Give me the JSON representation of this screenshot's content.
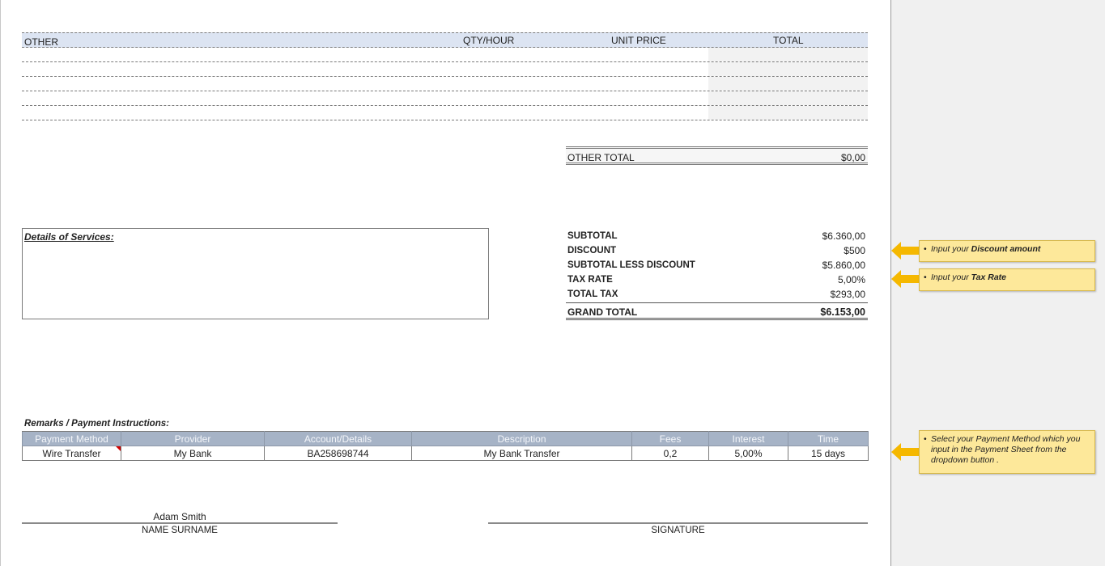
{
  "other_table": {
    "headers": {
      "other": "OTHER",
      "qty_hour": "QTY/HOUR",
      "unit_price": "UNIT PRICE",
      "total": "TOTAL"
    },
    "rows": [
      {
        "other": "",
        "qty": "",
        "unit_price": "",
        "total": ""
      },
      {
        "other": "",
        "qty": "",
        "unit_price": "",
        "total": ""
      },
      {
        "other": "",
        "qty": "",
        "unit_price": "",
        "total": ""
      },
      {
        "other": "",
        "qty": "",
        "unit_price": "",
        "total": ""
      },
      {
        "other": "",
        "qty": "",
        "unit_price": "",
        "total": ""
      }
    ]
  },
  "other_total": {
    "label": "OTHER TOTAL",
    "value": "$0,00"
  },
  "details": {
    "title": "Details of Services:"
  },
  "summary": {
    "subtotal_label": "SUBTOTAL",
    "subtotal_value": "$6.360,00",
    "discount_label": "DISCOUNT",
    "discount_value": "$500",
    "subtotal_less_discount_label": "SUBTOTAL LESS DISCOUNT",
    "subtotal_less_discount_value": "$5.860,00",
    "tax_rate_label": "TAX RATE",
    "tax_rate_value": "5,00%",
    "total_tax_label": "TOTAL TAX",
    "total_tax_value": "$293,00",
    "grand_total_label": "GRAND TOTAL",
    "grand_total_value": "$6.153,00"
  },
  "callouts": {
    "discount_prefix": "Input your ",
    "discount_bold": "Discount amount",
    "tax_prefix": "Input your ",
    "tax_bold": "Tax Rate",
    "payment_text": "Select your Payment Method which you input in the Payment Sheet from the dropdown button ."
  },
  "remarks": {
    "title": "Remarks / Payment Instructions:",
    "headers": [
      "Payment Method",
      "Provider",
      "Account/Details",
      "Description",
      "Fees",
      "Interest",
      "Time"
    ],
    "row": [
      "Wire Transfer",
      "My Bank",
      "BA258698744",
      "My Bank Transfer",
      "0,2",
      "5,00%",
      "15 days"
    ]
  },
  "signature": {
    "name": "Adam Smith",
    "name_label": "NAME SURNAME",
    "signature_label": "SIGNATURE"
  },
  "colors": {
    "header_fill": "#dce4f2",
    "pay_header_fill": "#a6b3c6",
    "callout_fill": "#fde89a",
    "arrow": "#f5b800",
    "comment_marker": "#d20000"
  },
  "icons": {
    "arrow": "left-arrow-icon"
  }
}
